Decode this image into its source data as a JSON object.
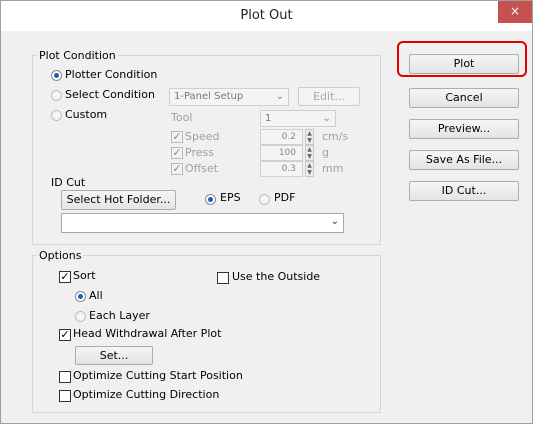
{
  "window": {
    "title": "Plot Out",
    "close_glyph": "×"
  },
  "plot_condition": {
    "legend": "Plot Condition",
    "plotter_condition": "Plotter Condition",
    "select_condition": "Select Condition",
    "custom": "Custom",
    "setup_select": "1-Panel Setup",
    "edit_button": "Edit...",
    "tool_label": "Tool",
    "tool_value": "1",
    "speed_label": "Speed",
    "speed_value": "0.2",
    "speed_unit": "cm/s",
    "press_label": "Press",
    "press_value": "100",
    "press_unit": "g",
    "offset_label": "Offset",
    "offset_value": "0.3",
    "offset_unit": "mm",
    "id_cut_label": "ID Cut",
    "select_hot_folder": "Select Hot Folder...",
    "eps": "EPS",
    "pdf": "PDF",
    "folder_value": ""
  },
  "options": {
    "legend": "Options",
    "sort": "Sort",
    "use_outside": "Use the Outside",
    "all": "All",
    "each_layer": "Each Layer",
    "head_withdrawal": "Head Withdrawal After Plot",
    "set_button": "Set...",
    "optimize_start": "Optimize Cutting Start Position",
    "optimize_direction": "Optimize Cutting Direction"
  },
  "buttons": {
    "plot": "Plot",
    "cancel": "Cancel",
    "preview": "Preview...",
    "save_as_file": "Save As File...",
    "id_cut": "ID Cut..."
  },
  "glyphs": {
    "check": "✓",
    "arrow_down": "⌄",
    "spin_up": "▲",
    "spin_down": "▼"
  },
  "colors": {
    "highlight": "#e00000",
    "close_button": "#c75050"
  }
}
